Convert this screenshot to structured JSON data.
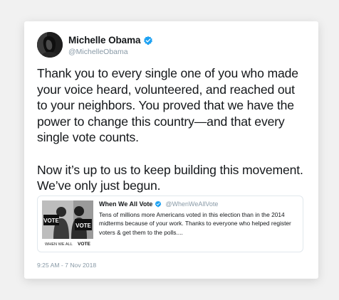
{
  "colors": {
    "background": "#f1f1f1",
    "card": "#ffffff",
    "text": "#14171a",
    "secondary_text": "#8899a6",
    "verified_blue": "#1da1f2",
    "border": "#e1e8ed"
  },
  "tweet": {
    "author": {
      "display_name": "Michelle Obama",
      "handle": "@MichelleObama",
      "verified": true,
      "avatar_icon": "profile-photo"
    },
    "paragraphs": [
      "Thank you to every single one of you who made your voice heard, volunteered, and reached out to your neighbors. You proved that we have the power to change this country—and that every single vote counts.",
      "Now it’s up to us to keep building this movement. We’ve only just begun."
    ],
    "quoted": {
      "display_name": "When We All Vote",
      "handle": "@WhenWeAllVote",
      "verified": true,
      "text": "Tens of millions more Americans voted in this election than in the 2014 midterms because of your work. Thanks to everyone who helped register voters & get them to the polls....",
      "image": {
        "sign_left": "VOTE",
        "sign_right": "VOTE",
        "caption_prefix": "WHEN WE ALL",
        "caption_suffix": "VOTE"
      }
    },
    "timestamp": "9:25 AM - 7 Nov 2018"
  }
}
